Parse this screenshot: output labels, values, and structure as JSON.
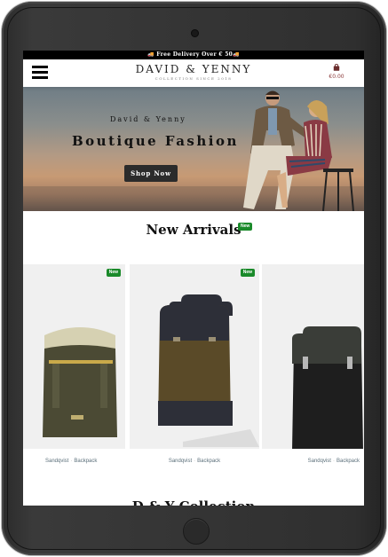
{
  "banner": {
    "text": "🚚 Free Delivery Over € 50🚚"
  },
  "header": {
    "brand": "DAVID & YENNY",
    "tagline": "COLLECTION SINCE 2018",
    "cart_total": "€0.00"
  },
  "hero": {
    "subtitle": "David & Yenny",
    "title": "Boutique Fashion",
    "button_label": "Shop Now"
  },
  "new_arrivals": {
    "title": "New Arrivals",
    "badge": "New"
  },
  "products": [
    {
      "badge": "New",
      "brand": "Sandqvist",
      "category": "Backpack",
      "color": "#4b4a34",
      "accent": "#d9d4b8"
    },
    {
      "badge": "New",
      "brand": "Sandqvist",
      "category": "Backpack",
      "color": "#5a4a28",
      "accent": "#2d2f38"
    },
    {
      "badge": "",
      "brand": "Sandqvist",
      "category": "Backpack",
      "color": "#1e1e1e",
      "accent": "#3a3d38"
    }
  ],
  "next_section": {
    "title": "D & Y Collection"
  },
  "icons": {
    "menu": "hamburger-icon",
    "cart": "shopping-bag-icon"
  },
  "colors": {
    "badge_green": "#1a8a2a",
    "price_red": "#8b3a3a",
    "caption_blue": "#5b6f7a"
  }
}
